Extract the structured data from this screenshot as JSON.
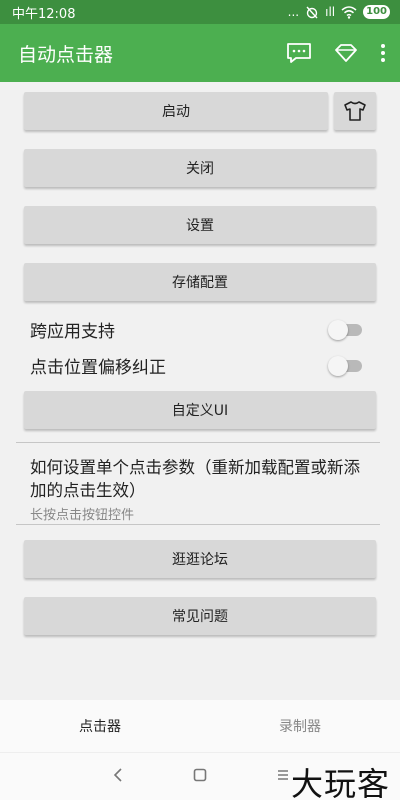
{
  "status_bar": {
    "time": "中午12:08",
    "dots": "...",
    "signal": "ıll",
    "battery": "100"
  },
  "app_bar": {
    "title": "自动点击器"
  },
  "buttons": {
    "start": "启动",
    "close": "关闭",
    "settings": "设置",
    "save_config": "存储配置",
    "custom_ui": "自定义UI",
    "forum": "逛逛论坛",
    "faq": "常见问题"
  },
  "toggles": {
    "cross_app": {
      "label": "跨应用支持",
      "on": false
    },
    "offset_fix": {
      "label": "点击位置偏移纠正",
      "on": false
    }
  },
  "info": {
    "title": "如何设置单个点击参数（重新加载配置或新添加的点击生效）",
    "subtitle": "长按点击按钮控件"
  },
  "bottom_nav": {
    "clicker": "点击器",
    "recorder": "录制器"
  },
  "watermark": "大玩客",
  "colors": {
    "primary": "#4caf50",
    "status": "#3d8f3f",
    "button": "#d8d8d8"
  }
}
